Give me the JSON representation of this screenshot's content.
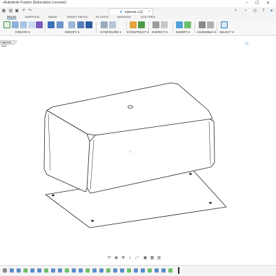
{
  "window": {
    "title": "- Autodesk Fusion (Education License)",
    "controls": [
      "–",
      "☐",
      "✕"
    ]
  },
  "document_tab": {
    "name": "internet v12",
    "saved_icon": "check-icon",
    "close": "×"
  },
  "workspace_tabs": [
    "SOLID",
    "SURFACE",
    "MESH",
    "SHEET METAL",
    "PLASTIC",
    "MANAGE",
    "UTILITIES"
  ],
  "active_workspace": "SOLID",
  "ribbon_groups": [
    {
      "label": "CREATE ▾",
      "icon": "create-sketch-icon"
    },
    {
      "label": "MODIFY ▾",
      "icon": "press-pull-icon"
    },
    {
      "label": "CONFIGURE ▾",
      "icon": "configure-icon"
    },
    {
      "label": "CONSTRUCT ▾",
      "icon": "offset-plane-icon"
    },
    {
      "label": "INSPECT ▾",
      "icon": "measure-icon"
    },
    {
      "label": "INSERT ▾",
      "icon": "insert-image-icon"
    },
    {
      "label": "ASSEMBLE ▾",
      "icon": "joint-icon"
    },
    {
      "label": "SELECT ▾",
      "icon": "select-arrow-icon"
    }
  ],
  "browser_tab": {
    "label": "nternet v12",
    "close": "×"
  },
  "colors": {
    "accent": "#2a7ab8",
    "ribbon_bg": "#f7f7f7",
    "model_stroke": "#222222",
    "model_face": "#ffffff"
  }
}
